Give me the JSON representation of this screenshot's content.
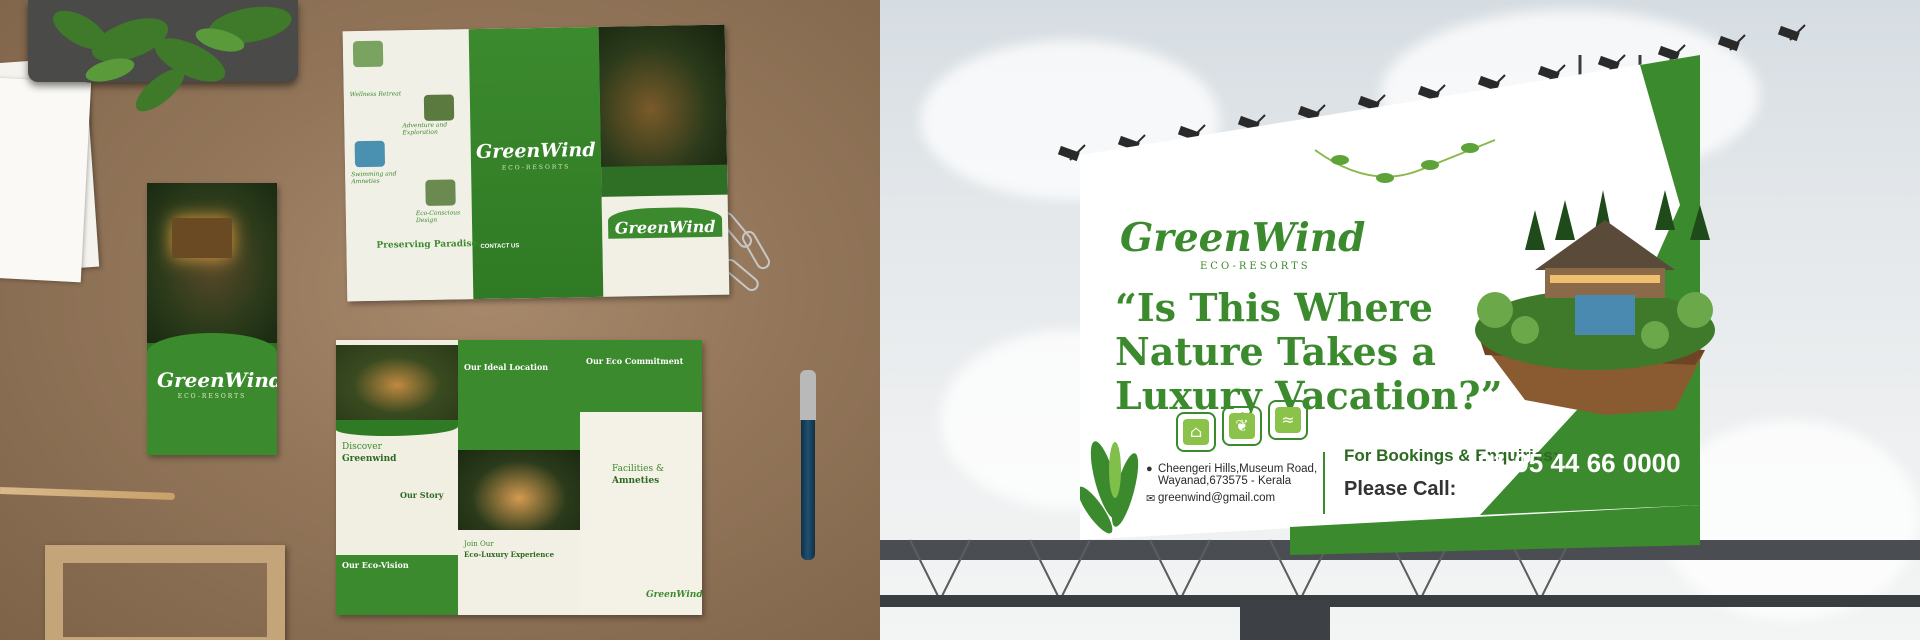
{
  "brand": {
    "name": "GreenWind",
    "sub": "ECO-RESORTS"
  },
  "billboard": {
    "headline": [
      "“Is This Where",
      "Nature Takes a",
      "Luxury Vacation?”"
    ],
    "address_line1": "Cheengeri Hills,Museum Road,",
    "address_line2": "Wayanad,673575 - Kerala",
    "email": "greenwind@gmail.com",
    "bookings": "For Bookings & Enquiries:",
    "please_call": "Please Call:",
    "phone": "+91 95 44 66 0000"
  },
  "brochure": {
    "preserving": "Preserving Paradise",
    "contact": "CONTACT US",
    "discover": "Discover",
    "greenwind": "Greenwind",
    "our_story": "Our Story",
    "eco_vision": "Our Eco-Vision",
    "ideal_location": "Our Ideal Location",
    "eco_commitment": "Our Eco Commitment",
    "facilities": "Facilities &",
    "amneties": "Amneties",
    "join_our": "Join Our",
    "eco_luxury": "Eco-Luxury Experience",
    "wellness": "Wellness Retreat",
    "adventure": "Adventure and Exploration",
    "swimming": "Swimming and Amneties",
    "eco_friendly": "Eco-Conscious Design"
  },
  "colors": {
    "green": "#3c8a2e",
    "dark_green": "#2c6a22",
    "light_green": "#8bc34a"
  }
}
